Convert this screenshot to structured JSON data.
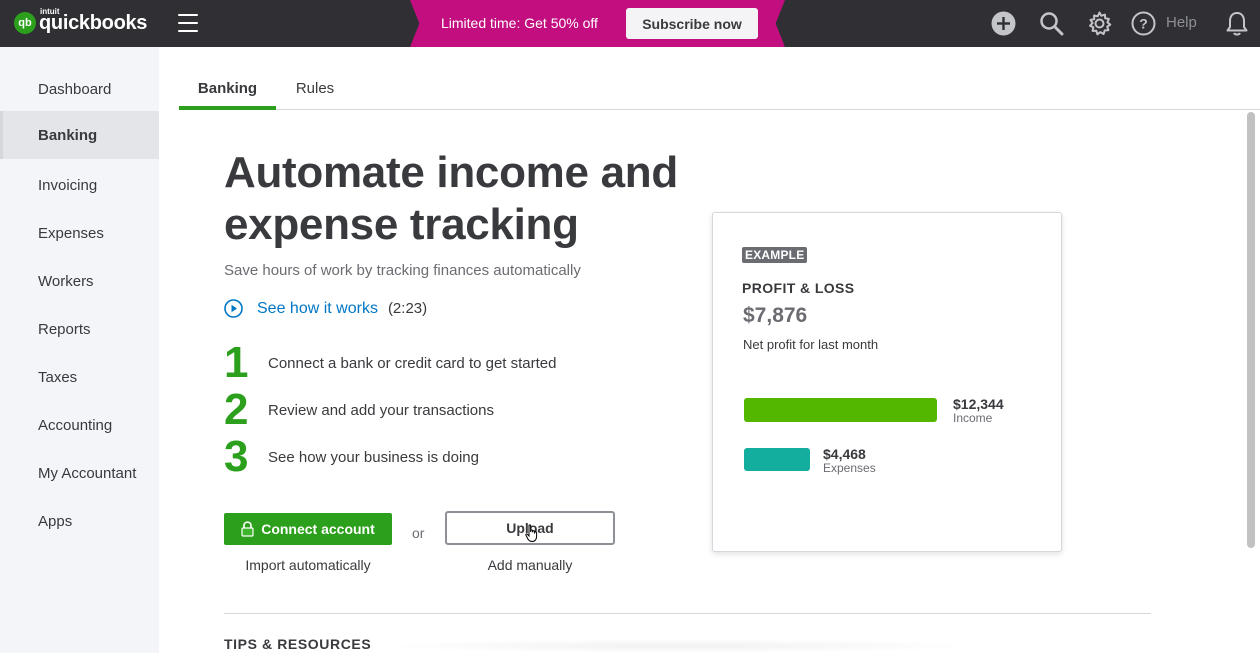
{
  "header": {
    "logo_brand": "intuit",
    "logo_name": "quickbooks",
    "promo_text": "Limited time: Get 50% off",
    "promo_button": "Subscribe now",
    "help_label": "Help",
    "icons": [
      "plus-circle-icon",
      "search-icon",
      "gear-icon",
      "help-icon",
      "bell-icon"
    ]
  },
  "sidebar": {
    "items": [
      {
        "label": "Dashboard",
        "active": false
      },
      {
        "label": "Banking",
        "active": true
      },
      {
        "label": "Invoicing",
        "active": false
      },
      {
        "label": "Expenses",
        "active": false
      },
      {
        "label": "Workers",
        "active": false
      },
      {
        "label": "Reports",
        "active": false
      },
      {
        "label": "Taxes",
        "active": false
      },
      {
        "label": "Accounting",
        "active": false
      },
      {
        "label": "My Accountant",
        "active": false
      },
      {
        "label": "Apps",
        "active": false
      }
    ]
  },
  "tabs": [
    {
      "label": "Banking",
      "active": true
    },
    {
      "label": "Rules",
      "active": false
    }
  ],
  "hero": {
    "title": "Automate income and expense tracking",
    "subtitle": "Save hours of work by tracking finances automatically",
    "video_link": "See how it works",
    "video_duration": "(2:23)"
  },
  "steps": [
    {
      "num": "1",
      "text": "Connect a bank or credit card to get started"
    },
    {
      "num": "2",
      "text": "Review and add your transactions"
    },
    {
      "num": "3",
      "text": "See how your business is doing"
    }
  ],
  "actions": {
    "connect_label": "Connect account",
    "connect_caption": "Import automatically",
    "or_text": "or",
    "upload_label": "Upload",
    "upload_caption": "Add manually"
  },
  "example_card": {
    "badge": "EXAMPLE",
    "title": "PROFIT & LOSS",
    "amount": "$7,876",
    "caption": "Net profit for last month",
    "income_value": "$12,344",
    "income_label": "Income",
    "income_amount": 12344,
    "expenses_value": "$4,468",
    "expenses_label": "Expenses",
    "expenses_amount": 4468,
    "income_color": "#53b700",
    "expenses_color": "#13ae9e"
  },
  "tips_title": "TIPS & RESOURCES",
  "colors": {
    "brand_green": "#2ca01c",
    "promo_magenta": "#c20e7f",
    "topbar": "#2f2f34",
    "link_blue": "#0077c5"
  }
}
